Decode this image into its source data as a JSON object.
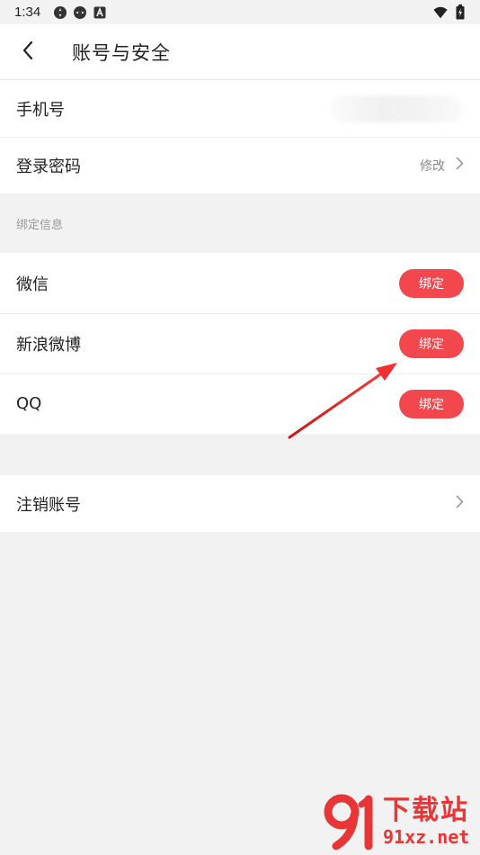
{
  "status_bar": {
    "time": "1:34",
    "left_icons": [
      "settings-app-icon",
      "settings-app-icon",
      "a-letter-icon"
    ],
    "right_icons": [
      "wifi-icon",
      "battery-charging-icon"
    ]
  },
  "header": {
    "title": "账号与安全",
    "back_icon": "chevron-left-icon"
  },
  "account": {
    "phone_label": "手机号",
    "password_label": "登录密码",
    "password_action": "修改"
  },
  "bindings": {
    "section_title": "绑定信息",
    "items": [
      {
        "label": "微信",
        "button": "绑定"
      },
      {
        "label": "新浪微博",
        "button": "绑定"
      },
      {
        "label": "QQ",
        "button": "绑定"
      }
    ]
  },
  "deactivate": {
    "label": "注销账号"
  },
  "watermark": {
    "cn": "下载站",
    "url": "91xz.net"
  },
  "colors": {
    "accent": "#f2474d",
    "annotation_arrow": "#e02020",
    "background": "#f2f2f2"
  }
}
